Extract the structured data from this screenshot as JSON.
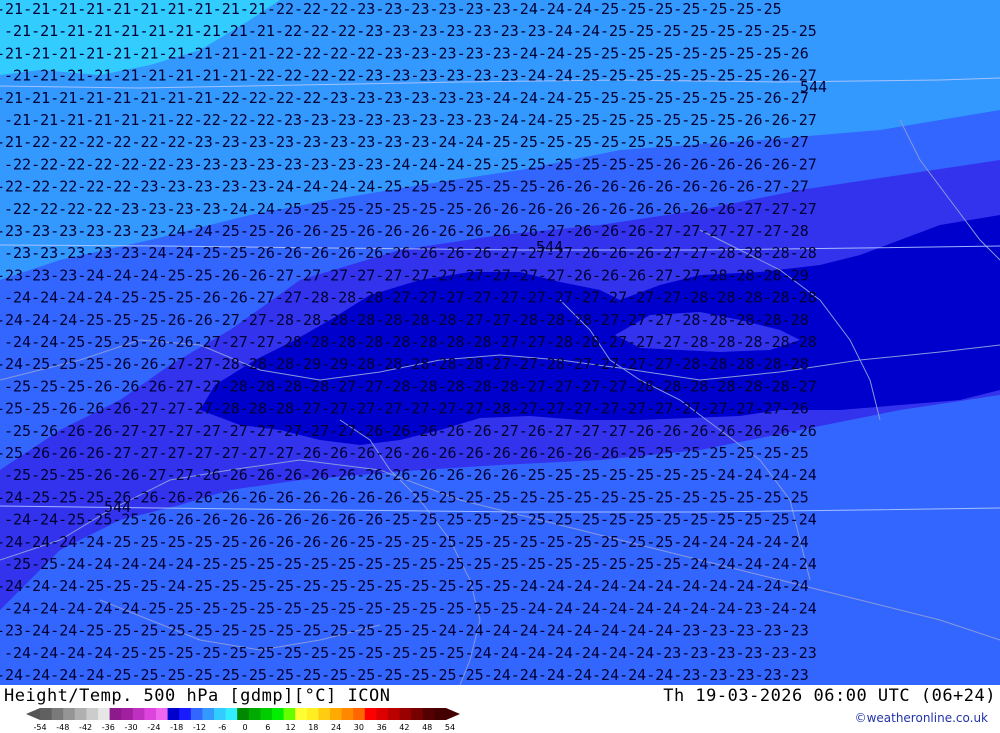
{
  "map": {
    "title": "Height/Temp. 500 hPa [gdmp][°C] ICON",
    "valid_time": "Th 19-03-2026 06:00 UTC (06+24)",
    "credit": "©weatheronline.co.uk",
    "region_labels": [
      "544",
      "544",
      "544"
    ],
    "colors": {
      "band_21": "#33ccff",
      "band_22_23": "#3399ff",
      "band_24_25": "#3366ff",
      "band_26_27": "#3333ee",
      "band_28": "#0000cc",
      "contour_line": "#cfe0ff",
      "border_line": "#8899dd"
    }
  },
  "legend": {
    "ticks": [
      "-54",
      "-48",
      "-42",
      "-36",
      "-30",
      "-24",
      "-18",
      "-12",
      "-6",
      "0",
      "6",
      "12",
      "18",
      "24",
      "30",
      "36",
      "42",
      "48",
      "54"
    ],
    "swatches": [
      "#606060",
      "#7a7a7a",
      "#959595",
      "#b0b0b0",
      "#cccccc",
      "#e6e6e6",
      "#8c1a8c",
      "#a020a0",
      "#c030c0",
      "#dd44dd",
      "#ee66ee",
      "#0000cc",
      "#1a1aff",
      "#3366ff",
      "#3399ff",
      "#33ccff",
      "#33eeff",
      "#008800",
      "#00aa00",
      "#00cc00",
      "#00ee00",
      "#66ff00",
      "#ffff33",
      "#ffee22",
      "#ffcc11",
      "#ffaa00",
      "#ff8800",
      "#ff6600",
      "#ff0000",
      "#dd0000",
      "#bb0000",
      "#990000",
      "#770000",
      "#550000",
      "#440000"
    ]
  },
  "isotherm_rows": [
    {
      "text": "-21-21-21-21-21-21-21-21-21-21-22-22-22-23-23-23-23-23-23-24-24-24-25-25-25-25-25-25-25"
    },
    {
      "text": "-21-21-21-21-21-21-21-21-21-21-22-22-22-23-23-23-23-23-23-23-24-24-25-25-25-25-25-25-25-25"
    },
    {
      "text": "-21-21-21-21-21-21-21-21-21-21-22-22-22-22-23-23-23-23-23-24-24-25-25-25-25-25-25-25-25-26"
    },
    {
      "text": "-21-21-21-21-21-21-21-21-21-22-22-22-22-23-23-23-23-23-23-24-24-25-25-25-25-25-25-25-26-27"
    },
    {
      "text": "-21-21-21-21-21-21-21-21-22-22-22-22-23-23-23-23-23-23-24-24-24-25-25-25-25-25-25-25-26-27"
    },
    {
      "text": "-21-21-21-21-21-21-22-22-22-22-23-23-23-23-23-23-23-23-24-24-25-25-25-25-25-25-25-26-26-27"
    },
    {
      "text": "-21-22-22-22-22-22-22-23-23-23-23-23-23-23-23-23-24-24-25-25-25-25-25-25-25-25-26-26-26-27"
    },
    {
      "text": "-22-22-22-22-22-22-23-23-23-23-23-23-23-23-24-24-24-25-25-25-25-25-25-25-26-26-26-26-26-27"
    },
    {
      "text": "-22-22-22-22-22-23-23-23-23-23-24-24-24-24-25-25-25-25-25-25-26-26-26-26-26-26-26-26-27-27"
    },
    {
      "text": "-22-22-22-22-23-23-23-23-24-24-25-25-25-25-25-25-25-26-26-26-26-26-26-26-26-26-26-27-27-27"
    },
    {
      "text": "-23-23-23-23-23-23-24-24-25-25-26-26-25-26-26-26-26-26-26-26-27-26-26-26-27-27-27-27-27-28"
    },
    {
      "text": "-23-23-23-23-23-24-24-25-25-26-26-26-26-26-26-26-26-26-27-27-27-26-26-26-27-27-28-28-28-28"
    },
    {
      "text": "-23-23-23-24-24-24-25-25-26-26-27-27-27-27-27-27-27-27-27-27-27-26-26-26-27-27-28-28-28-29"
    },
    {
      "text": "-24-24-24-24-25-25-25-26-26-27-27-28-28-28-27-27-27-27-27-27-27-27-27-27-27-28-28-28-28-28"
    },
    {
      "text": "-24-24-24-25-25-25-26-26-27-27-28-28-28-28-28-28-28-27-27-28-28-28-27-27-27-28-28-28-28-28"
    },
    {
      "text": "-24-24-25-25-25-26-26-27-27-27-28-28-28-28-28-28-28-28-27-27-28-28-27-27-27-28-28-28-28-28"
    },
    {
      "text": "-24-25-25-25-26-26-27-27-28-28-28-29-29-28-28-28-28-28-27-27-28-27-27-27-27-28-28-28-28-28"
    },
    {
      "text": "-25-25-25-26-26-26-27-27-28-28-28-28-27-27-28-28-28-28-28-27-27-27-27-28-28-28-28-28-28-27"
    },
    {
      "text": "-25-25-26-26-26-27-27-27-28-28-28-27-27-27-27-27-27-27-28-27-27-27-27-27-27-27-27-27-27-26"
    },
    {
      "text": "-25-26-26-26-27-27-27-27-27-27-27-27-27-26-26-26-26-26-27-26-27-27-27-26-26-26-26-26-26-26"
    },
    {
      "text": "-25-26-26-26-27-27-27-27-27-27-27-26-26-26-26-26-26-26-26-26-26-26-26-25-25-25-25-25-25-25"
    },
    {
      "text": "-25-25-25-26-26-27-27-26-26-26-26-26-26-26-26-26-26-26-26-25-25-25-25-25-25-25-24-24-24-24"
    },
    {
      "text": "-24-25-25-25-26-26-26-26-26-26-26-26-26-26-26-25-25-25-25-25-25-25-25-25-25-25-25-25-25-25"
    },
    {
      "text": "-24-24-25-25-25-26-26-26-26-26-26-26-26-26-25-25-25-25-25-25-25-25-25-25-25-25-25-25-25-24"
    },
    {
      "text": "-24-24-24-24-25-25-25-25-25-26-26-26-26-25-25-25-25-25-25-25-25-25-25-25-25-24-24-24-24-24"
    },
    {
      "text": "-25-25-24-24-24-24-24-25-25-25-25-25-25-25-25-25-25-25-25-25-25-25-25-25-25-24-24-24-24-24"
    },
    {
      "text": "-24-24-24-25-25-25-24-25-25-25-25-25-25-25-25-25-25-25-25-24-24-24-24-24-24-24-24-24-24-24"
    },
    {
      "text": "-24-24-24-24-24-25-25-25-25-25-25-25-25-25-25-25-25-25-25-24-24-24-24-24-24-24-24-23-24-24"
    },
    {
      "text": "-23-24-24-25-25-25-25-25-25-25-25-25-25-25-25-25-24-24-24-24-24-24-24-24-24-23-23-23-23-23"
    },
    {
      "text": "-24-24-24-24-25-25-25-25-25-25-25-25-25-25-25-25-25-24-24-24-24-24-24-24-23-23-23-23-23-23"
    },
    {
      "text": "-24-24-24-24-25-25-25-25-25-25-25-25-25-25-25-25-25-25-24-24-24-24-24-24-24-23-23-23-23-23"
    }
  ]
}
